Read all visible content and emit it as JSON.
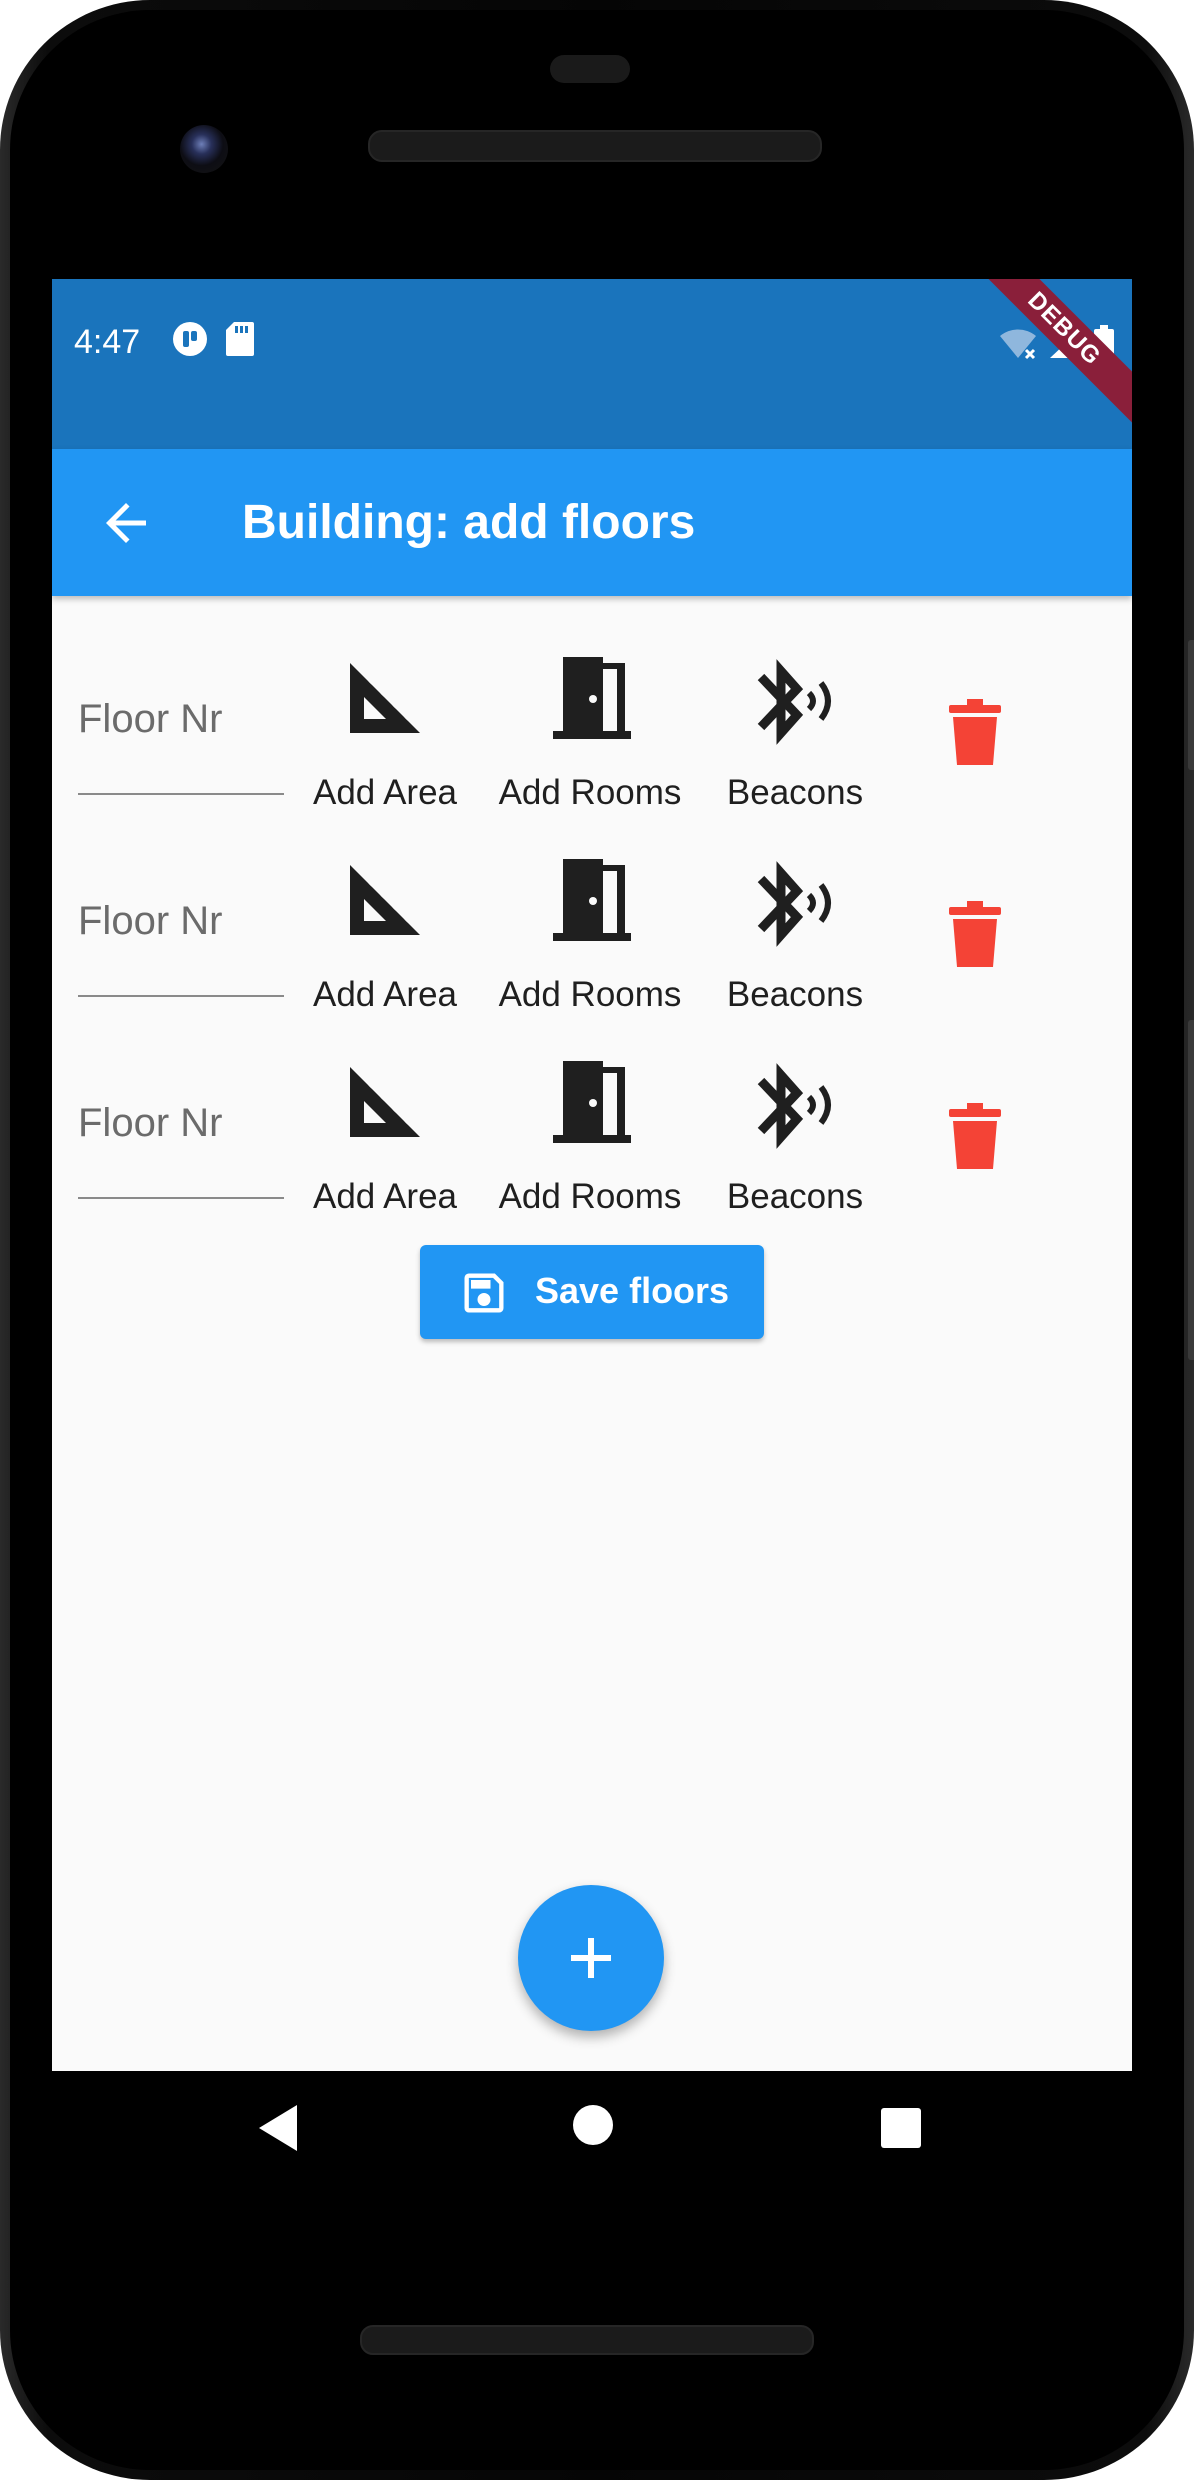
{
  "status_bar": {
    "time": "4:47",
    "debug_label": "DEBUG"
  },
  "app_bar": {
    "title": "Building: add floors",
    "back_icon": "arrow-back-icon"
  },
  "floors": [
    {
      "placeholder": "Floor Nr",
      "add_area": "Add Area",
      "add_rooms": "Add Rooms",
      "beacons": "Beacons"
    },
    {
      "placeholder": "Floor Nr",
      "add_area": "Add Area",
      "add_rooms": "Add Rooms",
      "beacons": "Beacons"
    },
    {
      "placeholder": "Floor Nr",
      "add_area": "Add Area",
      "add_rooms": "Add Rooms",
      "beacons": "Beacons"
    }
  ],
  "save_button": {
    "label": "Save floors",
    "icon": "save-icon"
  },
  "fab": {
    "icon": "add-icon"
  },
  "colors": {
    "status_bar": "#1a74bc",
    "app_bar": "#2196f3",
    "accent": "#2196f3",
    "delete": "#f44336",
    "background": "#fafafa"
  }
}
